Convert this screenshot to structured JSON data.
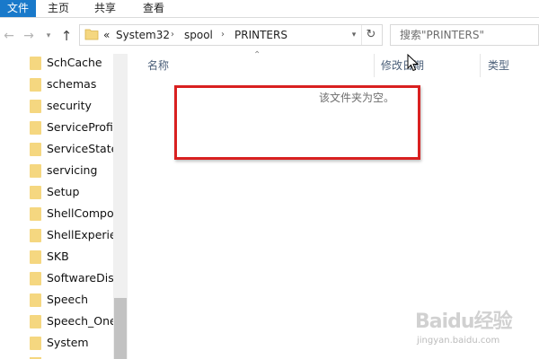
{
  "ribbon": {
    "tabs": [
      {
        "label": "文件"
      },
      {
        "label": "主页"
      },
      {
        "label": "共享"
      },
      {
        "label": "查看"
      }
    ]
  },
  "address": {
    "overflow": "«",
    "parts": [
      "System32",
      "spool",
      "PRINTERS"
    ]
  },
  "search": {
    "placeholder": "搜索\"PRINTERS\""
  },
  "nav_pane": {
    "items": [
      "SchCache",
      "schemas",
      "security",
      "ServiceProfiles",
      "ServiceState",
      "servicing",
      "Setup",
      "ShellComponents",
      "ShellExperiences",
      "SKB",
      "SoftwareDistribution",
      "Speech",
      "Speech_OneCore",
      "System"
    ]
  },
  "content": {
    "columns": {
      "name": "名称",
      "date": "修改日期",
      "type": "类型"
    },
    "empty_message": "该文件夹为空。"
  },
  "watermark": {
    "main": "Baidu经验",
    "sub": "jingyan.baidu.com"
  },
  "colors": {
    "file_tab": "#1979ca",
    "folder": "#f5d780",
    "highlight": "#d92020"
  }
}
